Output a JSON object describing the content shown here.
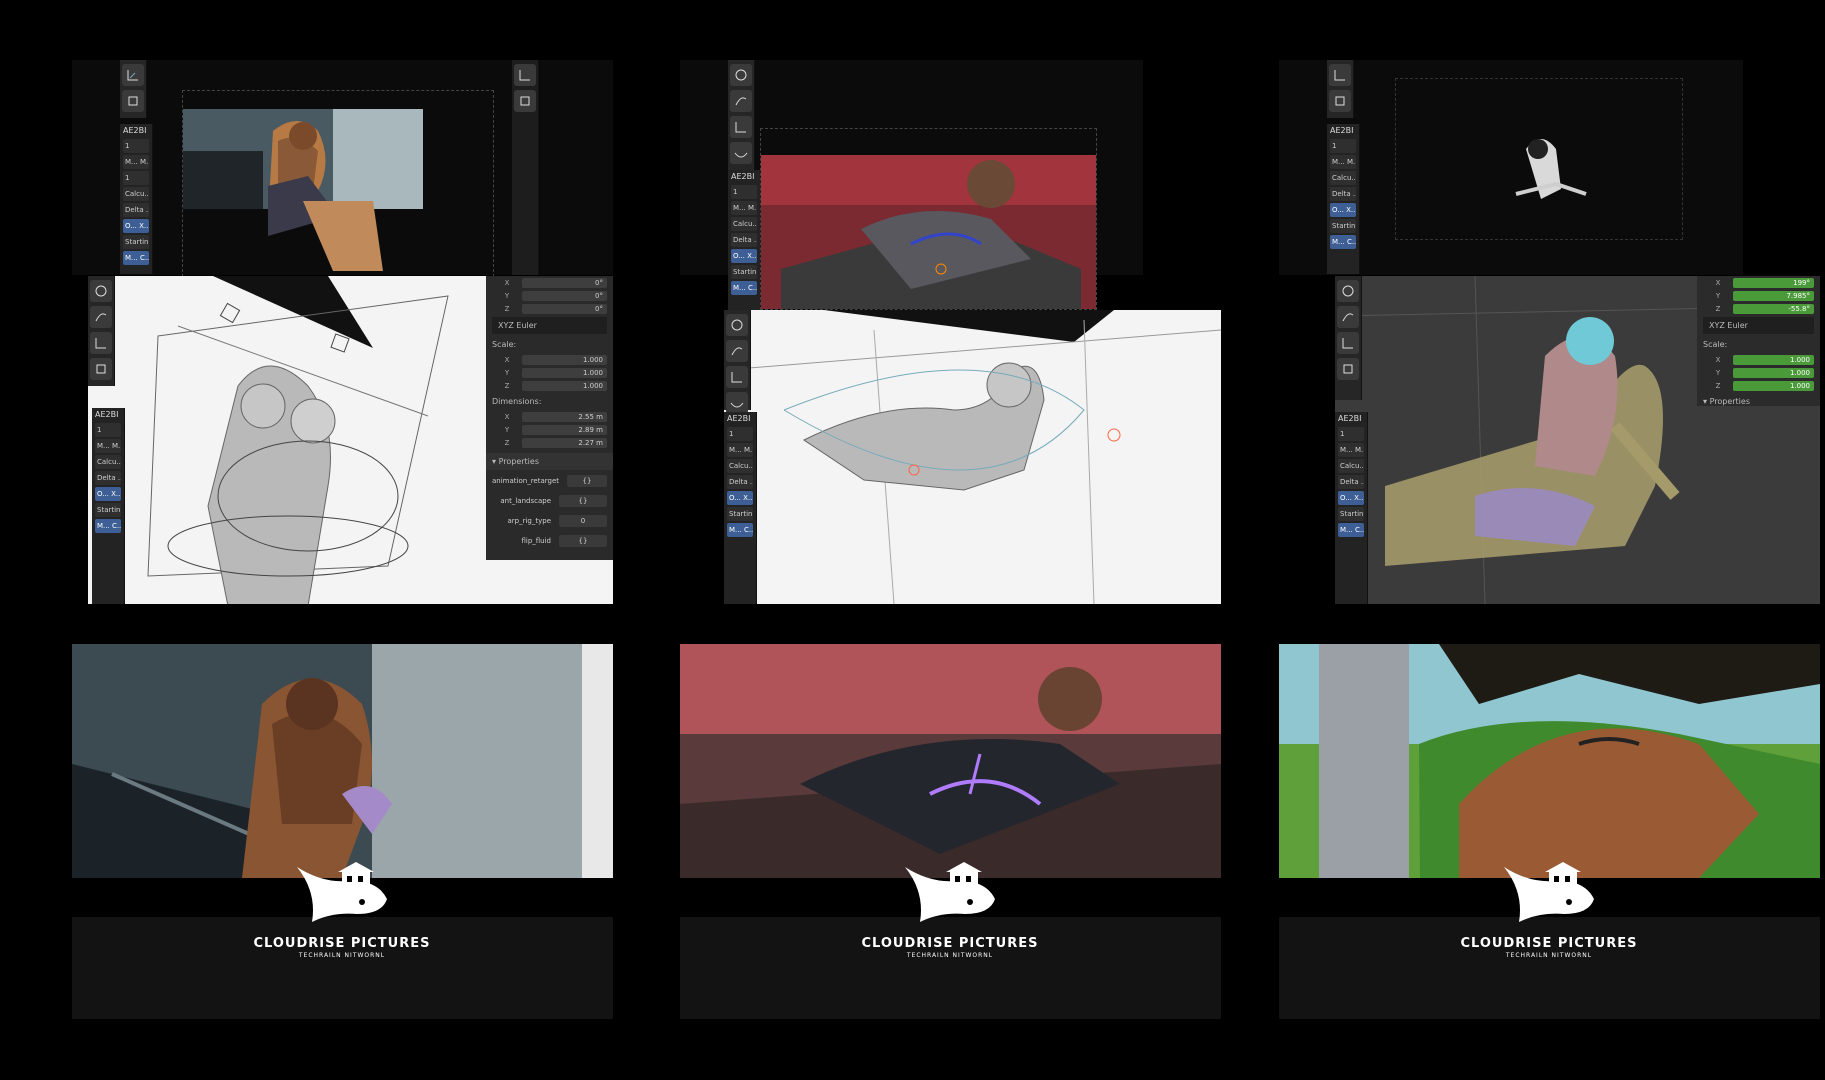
{
  "panel_label": "AE2BI",
  "mini_rows": [
    "1",
    "M... M...",
    "1",
    "Calcu...",
    "Delta ...",
    "O... X...",
    "Startin...",
    "M... C..."
  ],
  "transform_panel": {
    "rotation": {
      "x": "0°",
      "y": "0°",
      "z": "0°"
    },
    "rotation_mode": "XYZ Euler",
    "scale_label": "Scale:",
    "scale": {
      "x": "1.000",
      "y": "1.000",
      "z": "1.000"
    },
    "dimensions_label": "Dimensions:",
    "dimensions": {
      "x": "2.55 m",
      "y": "2.89 m",
      "z": "2.27 m"
    },
    "properties_label": "Properties",
    "properties": [
      {
        "key": "animation_retarget",
        "value": "{}"
      },
      {
        "key": "ant_landscape",
        "value": "{}"
      },
      {
        "key": "arp_rig_type",
        "value": "0"
      },
      {
        "key": "flip_fluid",
        "value": "{}"
      }
    ]
  },
  "transform_panel_3": {
    "rotation": {
      "x": "199°",
      "y": "7.985°",
      "z": "-55.8°"
    },
    "rotation_mode": "XYZ Euler",
    "scale_label": "Scale:",
    "scale": {
      "x": "1.000",
      "y": "1.000",
      "z": "1.000"
    },
    "properties_label": "Properties"
  },
  "axis": {
    "x": "X",
    "y": "Y",
    "z": "Z"
  },
  "logo": {
    "name": "CLOUDRISE PICTURES",
    "tagline": "TECHRAILN NITWORNL"
  },
  "colors": {
    "accent_blue": "#3d5f95",
    "field_green": "#4a9a3a",
    "panel_bg": "#2a2a2a"
  }
}
